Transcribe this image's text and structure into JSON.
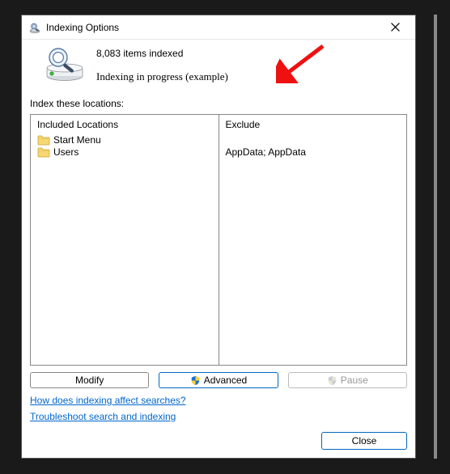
{
  "window": {
    "title": "Indexing Options"
  },
  "status": {
    "items_indexed": "8,083 items indexed",
    "progress": "Indexing in progress (example)"
  },
  "locations": {
    "label": "Index these locations:",
    "included_header": "Included Locations",
    "exclude_header": "Exclude",
    "included": [
      {
        "name": "Start Menu"
      },
      {
        "name": "Users"
      }
    ],
    "exclude": [
      {
        "text": ""
      },
      {
        "text": "AppData; AppData"
      }
    ]
  },
  "buttons": {
    "modify": "Modify",
    "advanced": "Advanced",
    "pause": "Pause",
    "close": "Close"
  },
  "links": {
    "help": "How does indexing affect searches?",
    "troubleshoot": "Troubleshoot search and indexing"
  }
}
